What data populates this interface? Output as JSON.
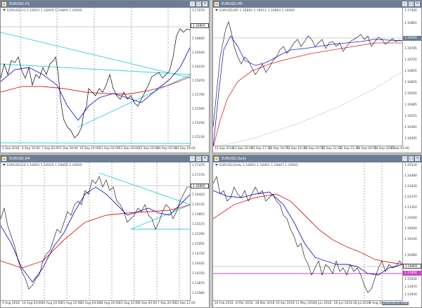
{
  "colors": {
    "candle": "#000000",
    "ma_fast": "#1f1fcc",
    "ma_slow": "#dd2222",
    "trend": "#33ccdd",
    "ma_long": "#44bb44",
    "vsep": "#444444",
    "cur_box": "#6b7d96",
    "magenta": "#cc44cc"
  },
  "windows": [
    {
      "title": "EURUSD,H1",
      "symbol": "EURUSD,H1  1.16921 1.16929 1.16893 1.16905",
      "prices": [
        "1.17070",
        "1.16905",
        "1.16840",
        "1.16540",
        "1.16230",
        "1.15970",
        "1.15790",
        "1.15590",
        "1.15430",
        "1.15230"
      ],
      "current": "1.16905",
      "times": [
        "5 Sep 2018",
        "6 Sep 10:00",
        "7 Sep 02:00",
        "7 Sep 18:00",
        "10 Sep 10:00",
        "11 Sep 02:00",
        "11 Sep 18:00",
        "12 Sep 10:00",
        "13 Sep 02:00",
        "13 Sep 18:00"
      ]
    },
    {
      "title": "EURUSD,M5",
      "symbol": "EURUSD,M5  1.16892 1.16911 1.16893 1.16905",
      "prices": [
        "1.17040",
        "1.16865",
        "1.16905",
        "1.16785",
        "1.16725",
        "1.16665",
        "1.16605",
        "1.16545",
        "1.16485",
        "1.16425",
        "1.16365",
        "1.16305"
      ],
      "current": "1.16905",
      "times": [
        "13 Sep 2018",
        "13 Sep 16:00",
        "13 Sep 17:35",
        "13 Sep 18:15",
        "13 Sep 19:35",
        "13 Sep 20:55",
        "13 Sep 22:15",
        "13 Sep 23:35",
        "14 Sep 00:55",
        "14 Sep 02:15",
        "14 Sep 03:40"
      ]
    },
    {
      "title": "EURUSD,H4",
      "symbol": "EURUSD,H4  1.16891 1.16929 1.16893 1.16905",
      "prices": [
        "1.17470",
        "1.17170",
        "1.16905",
        "1.16420",
        "1.16135",
        "1.15855",
        "1.15570",
        "1.15290",
        "1.15005",
        "1.14720",
        "1.14435",
        "1.14150",
        "1.13870",
        "1.13580"
      ],
      "current": "1.16905",
      "times": [
        "9 Aug 2018",
        "14 Aug 04:00",
        "16 Aug 20:00",
        "21 Aug 12:00",
        "24 Aug 04:00",
        "28 Aug 20:00",
        "31 Aug 12:00",
        "5 Sep 04:00",
        "7 Sep 20:00",
        "12 Sep 12:00"
      ]
    },
    {
      "title": "EURUSD,Daily",
      "symbol": "EURUSD,Daily  1.16891 1.16961 1.16847 1.16905",
      "prices": [
        "1.25530",
        "1.24480",
        "1.23420",
        "1.22370",
        "1.21310",
        "1.20260",
        "1.19200",
        "1.18140",
        "1.16905",
        "1.16080",
        "1.15030",
        "1.13970",
        "1.12920"
      ],
      "current": "1.16905",
      "current2": "1.15400",
      "times": [
        "16 Feb 2018",
        "8 Mar 2018",
        "28 Mar 2018",
        "20 Apr 2018",
        "11 May 2018",
        "4 Jun 2018",
        "26 Jun 2018",
        "18 Jul 2018",
        "9 Aug 20",
        "2018.09.05 0:00"
      ]
    }
  ]
}
